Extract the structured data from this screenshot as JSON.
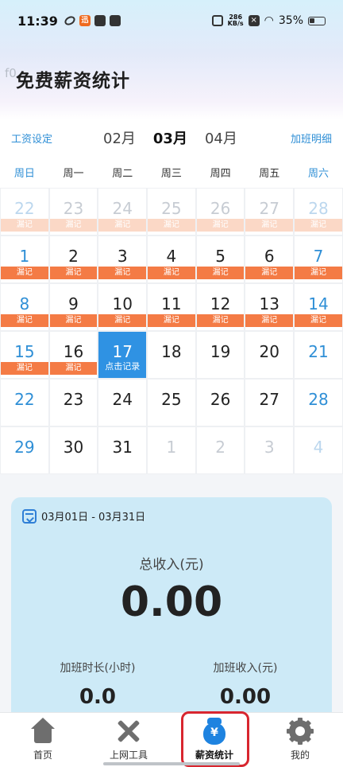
{
  "status_bar": {
    "time": "11:39",
    "net_speed": "286\nKB/s",
    "battery": "35%"
  },
  "header": {
    "ghost": "f0",
    "title": "免费薪资统计"
  },
  "month_bar": {
    "left_link": "工资设定",
    "prev_month": "02月",
    "current_month": "03月",
    "next_month": "04月",
    "right_link": "加班明细"
  },
  "calendar": {
    "weekdays": [
      "周日",
      "周一",
      "周二",
      "周三",
      "周四",
      "周五",
      "周六"
    ],
    "missed_label": "漏记",
    "today_label": "点击记录",
    "days": [
      {
        "n": "22",
        "kind": "prev",
        "tag": "漏记"
      },
      {
        "n": "23",
        "kind": "prev",
        "tag": "漏记"
      },
      {
        "n": "24",
        "kind": "prev",
        "tag": "漏记"
      },
      {
        "n": "25",
        "kind": "prev",
        "tag": "漏记"
      },
      {
        "n": "26",
        "kind": "prev",
        "tag": "漏记"
      },
      {
        "n": "27",
        "kind": "prev",
        "tag": "漏记"
      },
      {
        "n": "28",
        "kind": "prev",
        "tag": "漏记"
      },
      {
        "n": "1",
        "kind": "cur",
        "tag": "漏记"
      },
      {
        "n": "2",
        "kind": "cur",
        "tag": "漏记"
      },
      {
        "n": "3",
        "kind": "cur",
        "tag": "漏记"
      },
      {
        "n": "4",
        "kind": "cur",
        "tag": "漏记"
      },
      {
        "n": "5",
        "kind": "cur",
        "tag": "漏记"
      },
      {
        "n": "6",
        "kind": "cur",
        "tag": "漏记"
      },
      {
        "n": "7",
        "kind": "cur",
        "tag": "漏记"
      },
      {
        "n": "8",
        "kind": "cur",
        "tag": "漏记"
      },
      {
        "n": "9",
        "kind": "cur",
        "tag": "漏记"
      },
      {
        "n": "10",
        "kind": "cur",
        "tag": "漏记"
      },
      {
        "n": "11",
        "kind": "cur",
        "tag": "漏记"
      },
      {
        "n": "12",
        "kind": "cur",
        "tag": "漏记"
      },
      {
        "n": "13",
        "kind": "cur",
        "tag": "漏记"
      },
      {
        "n": "14",
        "kind": "cur",
        "tag": "漏记"
      },
      {
        "n": "15",
        "kind": "cur",
        "tag": "漏记"
      },
      {
        "n": "16",
        "kind": "cur",
        "tag": "漏记"
      },
      {
        "n": "17",
        "kind": "today",
        "tag": "点击记录"
      },
      {
        "n": "18",
        "kind": "cur",
        "tag": ""
      },
      {
        "n": "19",
        "kind": "cur",
        "tag": ""
      },
      {
        "n": "20",
        "kind": "cur",
        "tag": ""
      },
      {
        "n": "21",
        "kind": "cur",
        "tag": ""
      },
      {
        "n": "22",
        "kind": "cur",
        "tag": ""
      },
      {
        "n": "23",
        "kind": "cur",
        "tag": ""
      },
      {
        "n": "24",
        "kind": "cur",
        "tag": ""
      },
      {
        "n": "25",
        "kind": "cur",
        "tag": ""
      },
      {
        "n": "26",
        "kind": "cur",
        "tag": ""
      },
      {
        "n": "27",
        "kind": "cur",
        "tag": ""
      },
      {
        "n": "28",
        "kind": "cur",
        "tag": ""
      },
      {
        "n": "29",
        "kind": "cur",
        "tag": ""
      },
      {
        "n": "30",
        "kind": "cur",
        "tag": ""
      },
      {
        "n": "31",
        "kind": "cur",
        "tag": ""
      },
      {
        "n": "1",
        "kind": "next",
        "tag": ""
      },
      {
        "n": "2",
        "kind": "next",
        "tag": ""
      },
      {
        "n": "3",
        "kind": "next",
        "tag": ""
      },
      {
        "n": "4",
        "kind": "next",
        "tag": ""
      }
    ]
  },
  "summary": {
    "date_range": "03月01日 - 03月31日",
    "total_label": "总收入(元)",
    "total_value": "0.00",
    "overtime_hours_label": "加班时长(小时)",
    "overtime_hours_value": "0.0",
    "overtime_income_label": "加班收入(元)",
    "overtime_income_value": "0.00"
  },
  "bottom_nav": {
    "items": [
      {
        "label": "首页",
        "icon": "home-icon"
      },
      {
        "label": "上网工具",
        "icon": "tools-icon"
      },
      {
        "label": "薪资统计",
        "icon": "money-bag-icon"
      },
      {
        "label": "我的",
        "icon": "gear-icon"
      }
    ],
    "active_index": 2
  },
  "colors": {
    "accent": "#2f92e3",
    "missed_tag": "#f47b45",
    "highlight": "#d8262f"
  }
}
